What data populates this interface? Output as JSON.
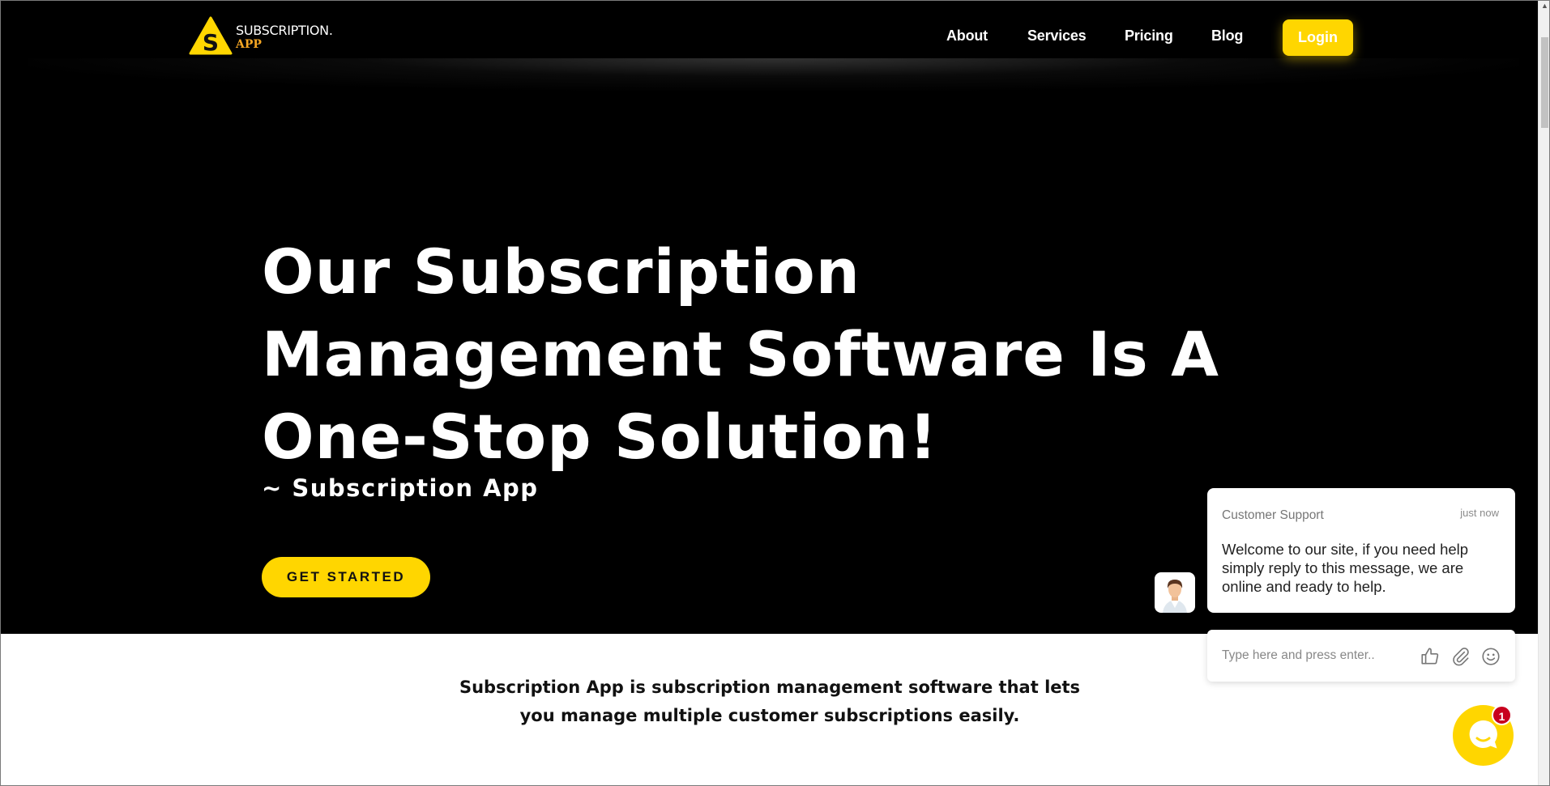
{
  "header": {
    "logo": {
      "line1": "SUBSCRIPTION.",
      "line2": "APP",
      "mark_letter": "S"
    },
    "nav": [
      {
        "label": "About"
      },
      {
        "label": "Services"
      },
      {
        "label": "Pricing"
      },
      {
        "label": "Blog"
      }
    ],
    "login_label": "Login"
  },
  "hero": {
    "title": "Our Subscription Management Software Is A One-Stop Solution!",
    "subtitle": "~ Subscription App",
    "cta_label": "GET STARTED"
  },
  "intro": {
    "text": "Subscription App is subscription management software that lets you manage multiple customer subscriptions easily."
  },
  "chat": {
    "from": "Customer Support",
    "time": "just now",
    "message": "Welcome to our site, if you need help simply reply to this message, we are online and ready to help.",
    "input_placeholder": "Type here and press enter..",
    "unread_count": "1",
    "icons": [
      "thumbs-up-icon",
      "paperclip-icon",
      "smiley-icon",
      "chat-bubble-icon"
    ]
  },
  "colors": {
    "accent": "#ffd600",
    "logo_orange": "#f5a623",
    "hero_bg": "#000000",
    "badge": "#c8001e"
  }
}
